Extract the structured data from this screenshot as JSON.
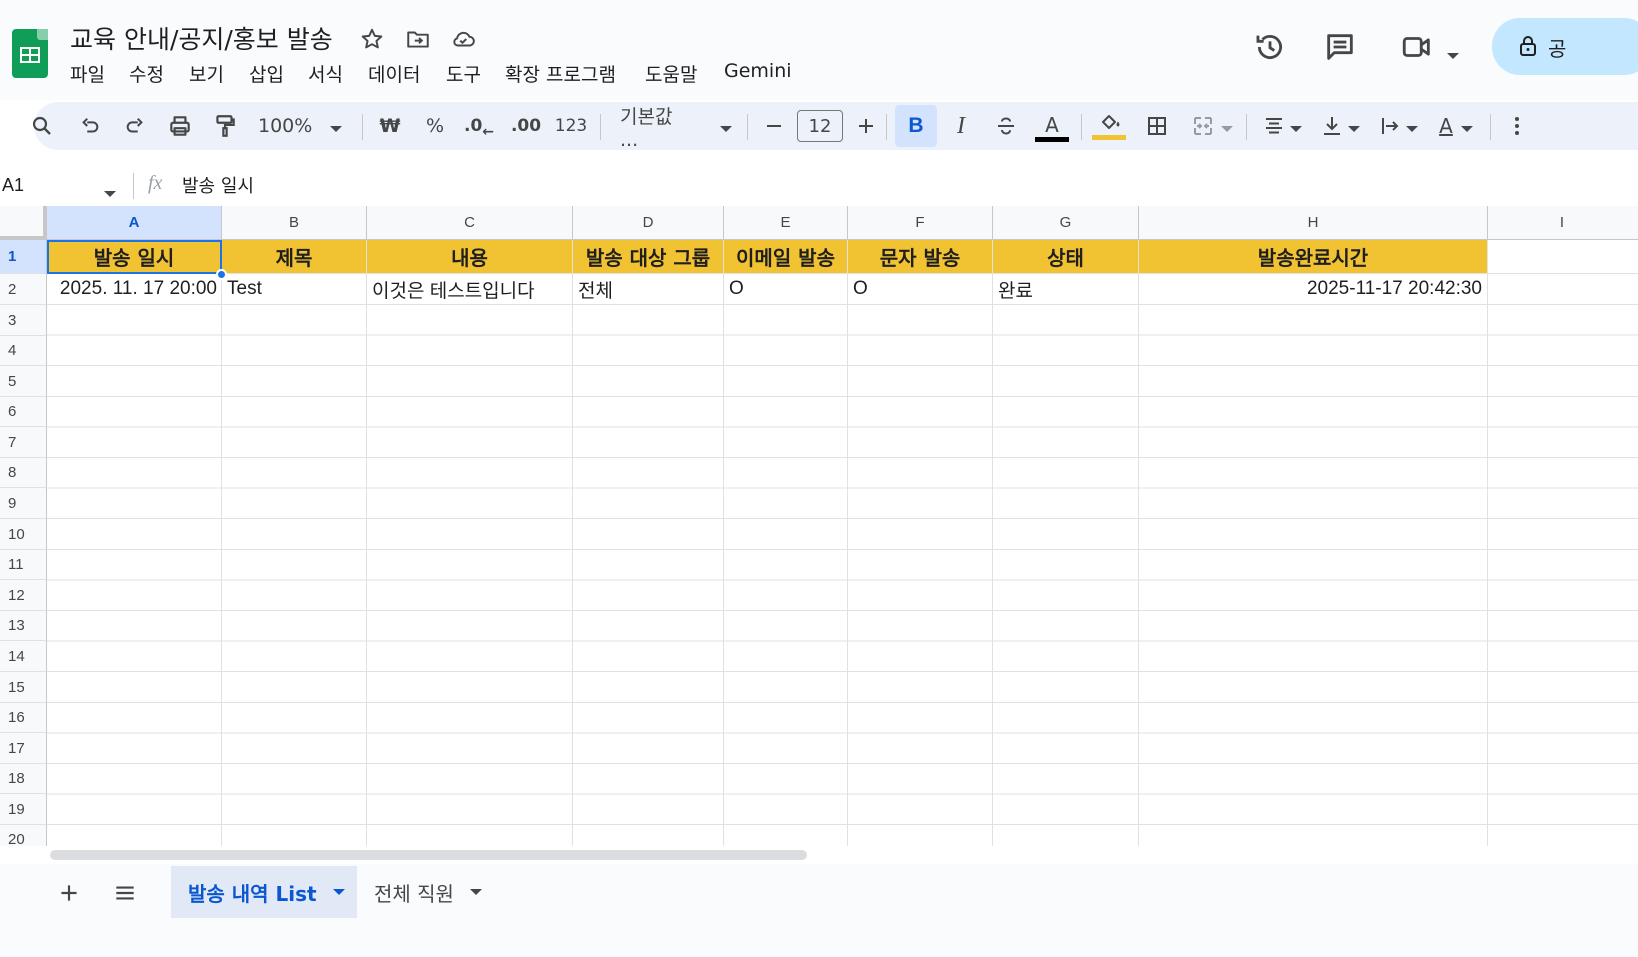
{
  "document": {
    "title": "교육 안내/공지/홍보 발송"
  },
  "menu": [
    "파일",
    "수정",
    "보기",
    "삽입",
    "서식",
    "데이터",
    "도구",
    "확장 프로그램",
    "도움말",
    "Gemini"
  ],
  "share": {
    "label": "공"
  },
  "toolbar": {
    "zoom": "100%",
    "currency": "₩",
    "percent": "%",
    "decrease_decimal": ".0",
    "increase_decimal": ".00",
    "number_format": "123",
    "font": "기본값 ...",
    "font_size": "12",
    "bold": "B",
    "italic": "I",
    "text_color": "A",
    "text_rotation": "A"
  },
  "formula_bar": {
    "cell_ref": "A1",
    "fx": "fx",
    "content": "발송 일시"
  },
  "columns": [
    "A",
    "B",
    "C",
    "D",
    "E",
    "F",
    "G",
    "H",
    "I"
  ],
  "rows": [
    "1",
    "2",
    "3",
    "4",
    "5",
    "6",
    "7",
    "8",
    "9",
    "10",
    "11",
    "12",
    "13",
    "14",
    "15",
    "16",
    "17",
    "18",
    "19",
    "20"
  ],
  "table": {
    "headers": [
      "발송 일시",
      "제목",
      "내용",
      "발송 대상 그룹",
      "이메일 발송",
      "문자 발송",
      "상태",
      "발송완료시간"
    ],
    "row2": [
      "2025. 11. 17 20:00",
      "Test",
      "이것은 테스트입니다",
      "전체",
      "O",
      "O",
      "완료",
      "2025-11-17 20:42:30"
    ]
  },
  "sheets": [
    {
      "name": "발송 내역 List",
      "active": true
    },
    {
      "name": "전체 직원",
      "active": false
    }
  ],
  "colors": {
    "header_fill": "#f1c232",
    "selection": "#1a73e8",
    "share_bg": "#c2e7ff"
  }
}
